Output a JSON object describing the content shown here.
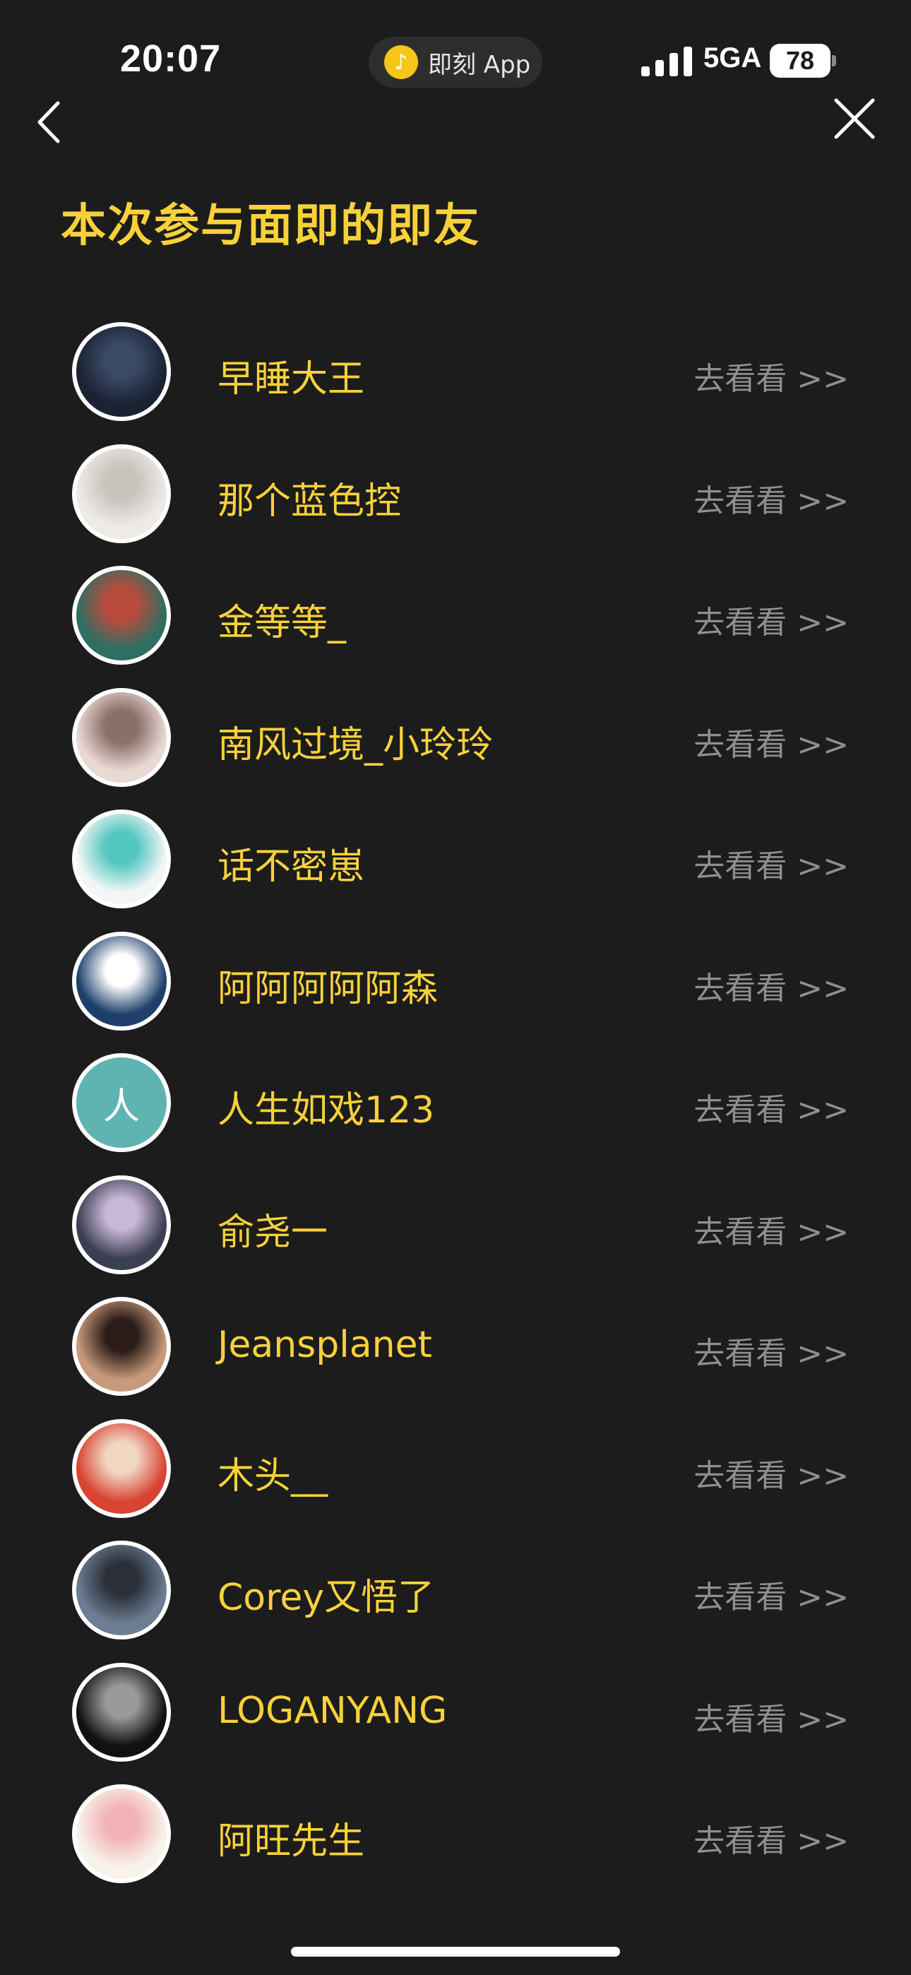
{
  "status_bar": {
    "time": "20:07",
    "app_pill_label": "即刻 App",
    "network": "5GA",
    "battery": "78"
  },
  "page": {
    "title": "本次参与面即的即友"
  },
  "friends": [
    {
      "name": "早睡大王",
      "link": "去看看 >>",
      "avatar_icon": "avatar-photo-icon",
      "avatar_colors": [
        "#1b2233",
        "#3a4a66"
      ]
    },
    {
      "name": "那个蓝色控",
      "link": "去看看 >>",
      "avatar_icon": "avatar-cat-icon",
      "avatar_colors": [
        "#eeeae6",
        "#c9c3bd"
      ]
    },
    {
      "name": "金等等_",
      "link": "去看看 >>",
      "avatar_icon": "avatar-photo-icon",
      "avatar_colors": [
        "#2f6e63",
        "#b94b3c"
      ]
    },
    {
      "name": "南风过境_小玲玲",
      "link": "去看看 >>",
      "avatar_icon": "avatar-cat-icon",
      "avatar_colors": [
        "#e9d9d3",
        "#8a6f6a"
      ]
    },
    {
      "name": "话不密崽",
      "link": "去看看 >>",
      "avatar_icon": "avatar-anime-icon",
      "avatar_colors": [
        "#f2f6f6",
        "#54c7c0"
      ]
    },
    {
      "name": "阿阿阿阿阿森",
      "link": "去看看 >>",
      "avatar_icon": "avatar-logo-icon",
      "avatar_colors": [
        "#1d3f6a",
        "#ffffff"
      ]
    },
    {
      "name": "人生如戏123",
      "link": "去看看 >>",
      "avatar_icon": "avatar-initial-icon",
      "avatar_initial": "人",
      "avatar_colors": [
        "#5fb3b0",
        "#5fb3b0"
      ]
    },
    {
      "name": "俞尧一",
      "link": "去看看 >>",
      "avatar_icon": "avatar-photo-icon",
      "avatar_colors": [
        "#3b3f52",
        "#c9b7d8"
      ]
    },
    {
      "name": "Jeansplanet",
      "link": "去看看 >>",
      "avatar_icon": "avatar-photo-icon",
      "avatar_colors": [
        "#c89a7c",
        "#2b1c17"
      ]
    },
    {
      "name": "木头__",
      "link": "去看看 >>",
      "avatar_icon": "avatar-illustration-icon",
      "avatar_colors": [
        "#d94333",
        "#f1d6c2"
      ]
    },
    {
      "name": "Corey又悟了",
      "link": "去看看 >>",
      "avatar_icon": "avatar-photo-icon",
      "avatar_colors": [
        "#6d7d93",
        "#2a2f38"
      ]
    },
    {
      "name": "LOGANYANG",
      "link": "去看看 >>",
      "avatar_icon": "avatar-photo-icon",
      "avatar_colors": [
        "#111111",
        "#9a9a9a"
      ]
    },
    {
      "name": "阿旺先生",
      "link": "去看看 >>",
      "avatar_icon": "avatar-pig-icon",
      "avatar_colors": [
        "#f7f3ea",
        "#f3b3b6"
      ]
    }
  ]
}
